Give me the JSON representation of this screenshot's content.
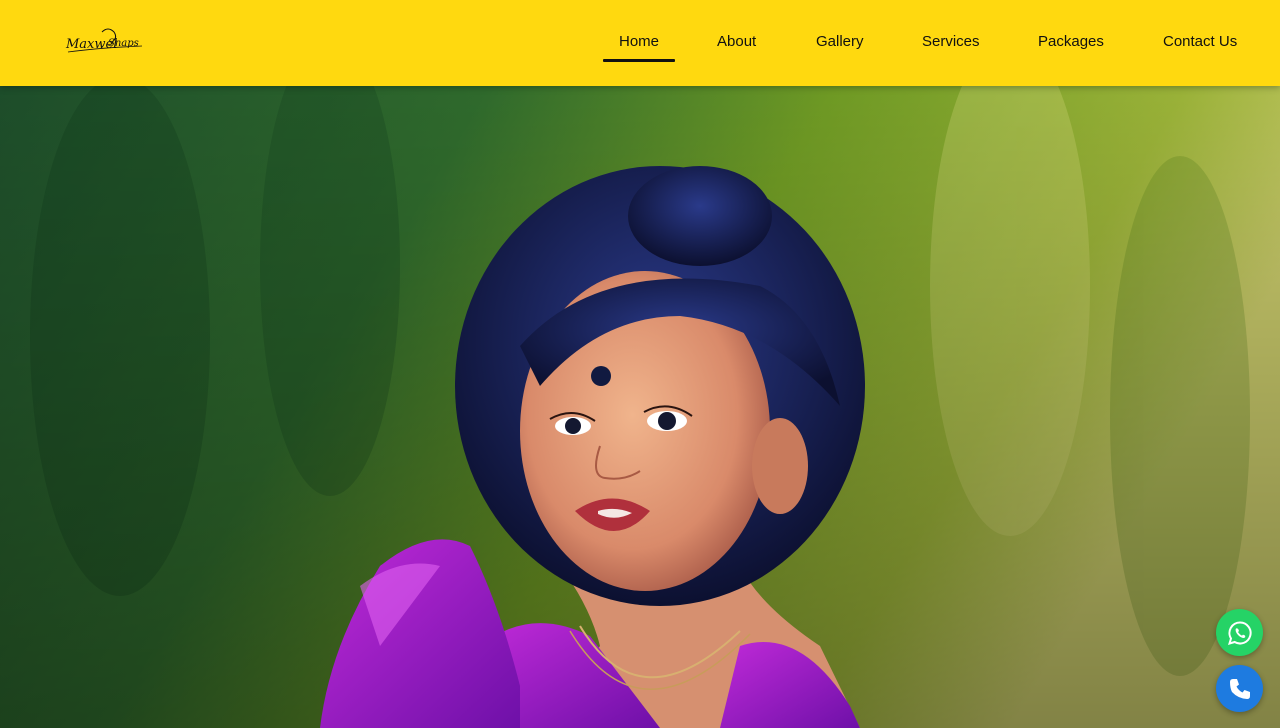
{
  "brand": {
    "name": "Maxwel Snaps",
    "logo_text_1": "Maxwel",
    "logo_text_2": "Snaps"
  },
  "nav": {
    "items": [
      {
        "label": "Home",
        "active": true
      },
      {
        "label": "About",
        "active": false
      },
      {
        "label": "Gallery",
        "active": false
      },
      {
        "label": "Services",
        "active": false
      },
      {
        "label": "Packages",
        "active": false
      },
      {
        "label": "Contact Us",
        "active": false
      }
    ]
  },
  "hero": {
    "image": "painted-portrait-of-toddler-girl-in-purple-dress"
  },
  "floating_actions": {
    "whatsapp_icon": "whatsapp-icon",
    "phone_icon": "phone-icon"
  },
  "colors": {
    "header_bg": "#ffd90f",
    "nav_text": "#111111",
    "whatsapp": "#25d366",
    "phone": "#1e7be0"
  }
}
